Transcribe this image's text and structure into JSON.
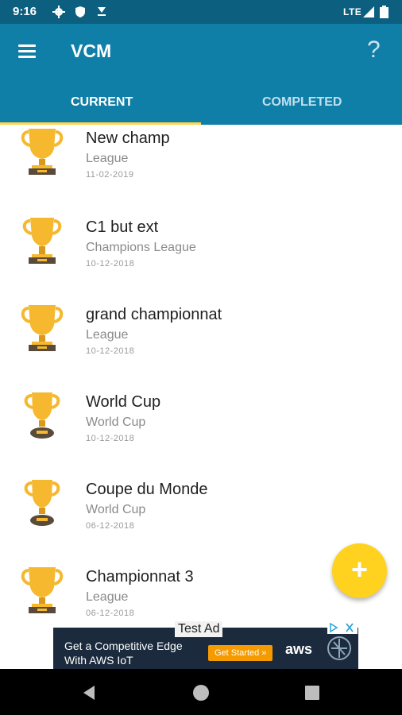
{
  "status": {
    "time": "9:16",
    "network": "LTE",
    "icons": [
      "settings-icon",
      "shield-icon",
      "download-icon",
      "signal-icon",
      "battery-icon"
    ]
  },
  "appbar": {
    "title": "VCM",
    "menu_icon": "menu-icon",
    "help_label": "?",
    "background": "#0f7fa8"
  },
  "tabs": [
    {
      "label": "CURRENT",
      "active": true
    },
    {
      "label": "COMPLETED",
      "active": false
    }
  ],
  "competitions": [
    {
      "name": "New champ",
      "type": "League",
      "date": "11-02-2019"
    },
    {
      "name": "C1 but ext",
      "type": "Champions League",
      "date": "10-12-2018"
    },
    {
      "name": "grand championnat",
      "type": "League",
      "date": "10-12-2018"
    },
    {
      "name": "World Cup",
      "type": "World Cup",
      "date": "10-12-2018"
    },
    {
      "name": "Coupe du Monde",
      "type": "World Cup",
      "date": "06-12-2018"
    },
    {
      "name": "Championnat 3",
      "type": "League",
      "date": "06-12-2018"
    }
  ],
  "fab": {
    "label": "+",
    "color": "#ffd21f"
  },
  "ad": {
    "label": "Test Ad",
    "text_line1": "Get a Competitive Edge",
    "text_line2": "With AWS IoT",
    "cta": "Get Started »",
    "brand": "aws"
  },
  "colors": {
    "accent": "#ffd54f",
    "trophy": "#f5b82e"
  }
}
